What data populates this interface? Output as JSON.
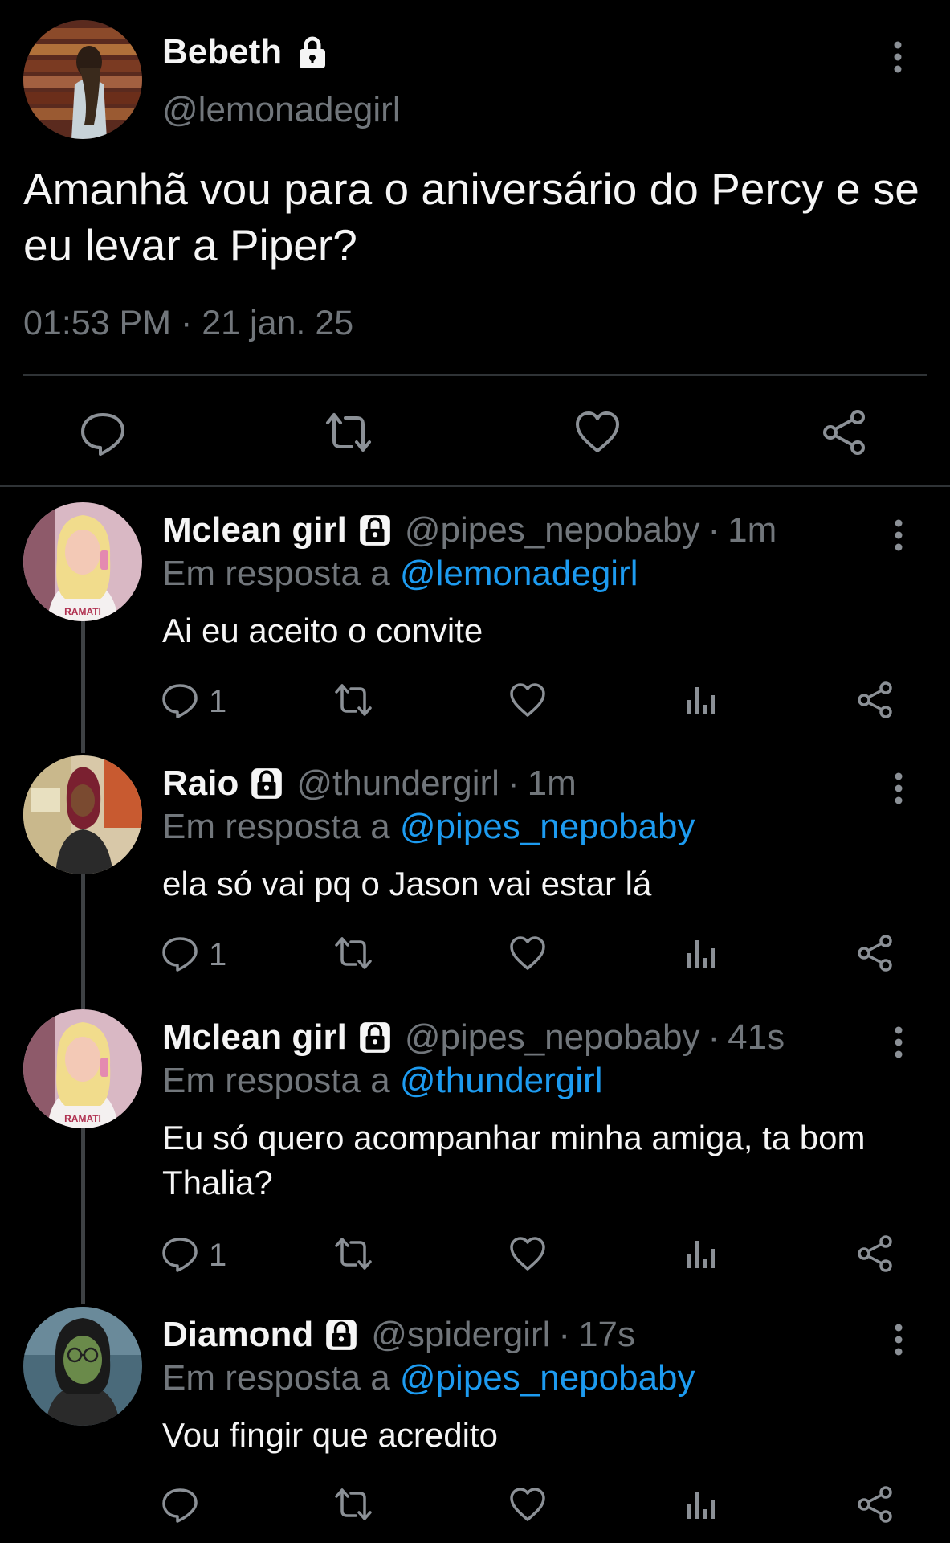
{
  "main_tweet": {
    "author_name": "Bebeth",
    "handle": "@lemonadegirl",
    "text": "Amanhã vou para o aniversário do Percy e se eu levar a Piper?",
    "meta": "01:53 PM · 21 jan. 25",
    "lock_icon": "lock-icon",
    "actions": [
      "reply-icon",
      "retweet-icon",
      "like-icon",
      "share-icon"
    ]
  },
  "replies": [
    {
      "name": "Mclean girl",
      "handle": "@pipes_nepobaby",
      "time": "1m",
      "reply_prefix": "Em resposta a ",
      "reply_to": "@lemonadegirl",
      "text": "Ai eu aceito o convite",
      "reply_count": "1"
    },
    {
      "name": "Raio",
      "handle": "@thundergirl",
      "time": "1m",
      "reply_prefix": "Em resposta a ",
      "reply_to": "@pipes_nepobaby",
      "text": "ela só vai pq o Jason vai estar lá",
      "reply_count": "1"
    },
    {
      "name": "Mclean girl",
      "handle": "@pipes_nepobaby",
      "time": "41s",
      "reply_prefix": "Em resposta a ",
      "reply_to": "@thundergirl",
      "text": "Eu só quero acompanhar minha amiga, ta bom Thalia?",
      "reply_count": "1"
    },
    {
      "name": "Diamond",
      "handle": "@spidergirl",
      "time": "17s",
      "reply_prefix": "Em resposta a ",
      "reply_to": "@pipes_nepobaby",
      "text": "Vou fingir que acredito",
      "reply_count": ""
    }
  ],
  "separator": "·",
  "colors": {
    "background": "#000000",
    "text": "#f5f5f5",
    "muted": "#71767b",
    "mention": "#1d9bf0",
    "divider": "#2f3336"
  }
}
